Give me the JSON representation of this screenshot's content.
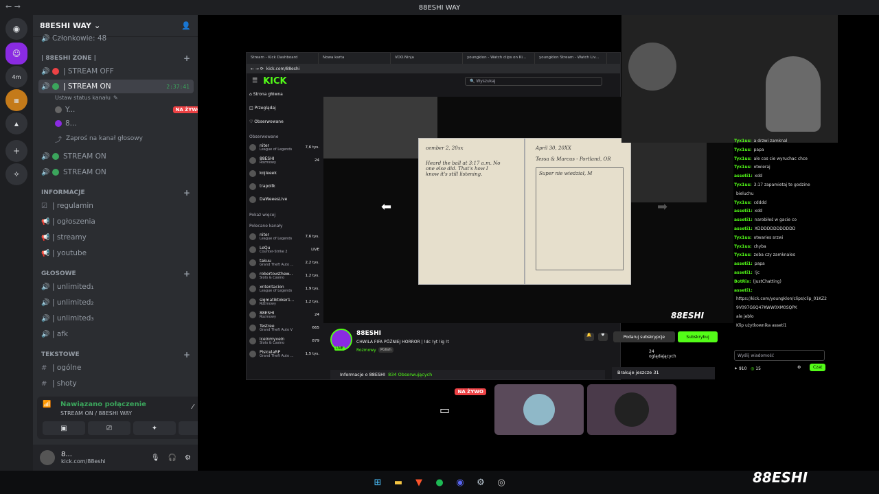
{
  "titlebar": {
    "title": "88ESHI WAY"
  },
  "server": {
    "name": "88ESHI WAY",
    "members_partial": "Członkowie: 48"
  },
  "channels": {
    "zone_category": "| 88ESHI ZONE |",
    "stream_off": "| STREAM OFF",
    "stream_on": "| STREAM ON",
    "stream_on_timer": "2:37:41",
    "status_hint": "Ustaw status kanału",
    "user1": "Y...",
    "user2": "8...",
    "live_badge": "NA ŻYWO",
    "invite": "Zaproś na kanał głosowy",
    "stream_on_2": "STREAM ON",
    "stream_on_3": "STREAM ON",
    "info_category": "INFORMACJE",
    "regulamin": "| regulamin",
    "ogloszenia": "| ogłoszenia",
    "streamy": "| streamy",
    "youtube": "| youtube",
    "voice_category": "GŁOSOWE",
    "unlimited1": "| unlimited₁",
    "unlimited2": "| unlimited₂",
    "unlimited3": "| unlimited₃",
    "afk": "| afk",
    "text_category": "TEKSTOWE",
    "ogolne": "| ogólne",
    "shoty": "| shoty"
  },
  "voice": {
    "status": "Nawiązano połączenie",
    "channel": "STREAM ON / 88ESHI WAY"
  },
  "user": {
    "name": "8...",
    "status": "kick.com/88eshi"
  },
  "browser": {
    "tabs": [
      "Stream - Kick Dashboard",
      "Nowa karta",
      "VDO.Ninja",
      "youngklon - Watch clips on Ki...",
      "youngklon Stream - Watch Liv..."
    ],
    "url": "kick.com/88eshi",
    "search_placeholder": "Wyszukaj",
    "logo": "KICK",
    "nav": {
      "home": "Strona główna",
      "browse": "Przeglądaj",
      "following": "Obserwowane"
    },
    "followed_header": "Obserwowane",
    "followed": [
      {
        "name": "niter",
        "game": "League of Legends",
        "count": "7,6 tys."
      },
      {
        "name": "88ESHI",
        "game": "Rozmowy",
        "count": "24"
      },
      {
        "name": "kojleeek",
        "game": "",
        "count": ""
      },
      {
        "name": "trapollk",
        "game": "",
        "count": ""
      },
      {
        "name": "DaWeeesLive",
        "game": "",
        "count": ""
      }
    ],
    "show_more": "Pokaż więcej",
    "recommended_header": "Polecane kanały",
    "recommended": [
      {
        "name": "niter",
        "game": "League of Legends",
        "count": "7,6 tys."
      },
      {
        "name": "LeQu",
        "game": "Counter-Strike 2",
        "count": "LIVE"
      },
      {
        "name": "takuu",
        "game": "Grand Theft Auto ...",
        "count": "2,2 tys."
      },
      {
        "name": "robertovsthew...",
        "game": "Slots & Casino",
        "count": "1,2 tys."
      },
      {
        "name": "xntentacion",
        "game": "League of Legends",
        "count": "1,9 tys."
      },
      {
        "name": "sigmatiktoker1...",
        "game": "Rozmowy",
        "count": "1,2 tys."
      },
      {
        "name": "88ESHI",
        "game": "Rozmowy",
        "count": "24"
      },
      {
        "name": "Testree",
        "game": "Grand Theft Auto V",
        "count": "665"
      },
      {
        "name": "iceinmyvein",
        "game": "Slots & Casino",
        "count": "879"
      },
      {
        "name": "PisicelaRP",
        "game": "Grand Theft Auto ...",
        "count": "1,5 tys."
      }
    ],
    "journal": {
      "left_date": "cember 2, 20xx",
      "right_date": "April 30, 20XX",
      "right_sub": "Tessa & Marcus - Portland, OR",
      "left_text": "Heard the ball at 3:17 a.m. No one else did. That's how I know it's still listening.",
      "right_text": "Super nie wiedział, M"
    },
    "channel_name": "88ESHI",
    "stream_title": "CHWILA FIFA PÓŹNIEJ HORROR | !dc !yt !ig !t",
    "category": "Rozmowy",
    "tag": "Polish",
    "live": "LIVE",
    "gift_btn": "Podaruj subskrypcje",
    "sub_btn": "Subskrybuj",
    "viewers": "24 oglądających",
    "about": "Informacje o 88ESHI",
    "followers": "834 Obserwujących",
    "goal": "Brakuje jeszcze 31"
  },
  "chat": {
    "messages": [
      {
        "user": "Tyx1us:",
        "text": "a drzwi zamknal"
      },
      {
        "user": "Tyx1us:",
        "text": "papa"
      },
      {
        "user": "Tyx1us:",
        "text": "ale cos cie wyruchac chce"
      },
      {
        "user": "Tyx1us:",
        "text": "otwieraj"
      },
      {
        "user": "asseti1:",
        "text": "xdd"
      },
      {
        "user": "Tyx1us:",
        "text": "3:17 zapamietaj te godzine"
      },
      {
        "user": "",
        "text": "bieluchu"
      },
      {
        "user": "Tyx1us:",
        "text": "cdddd"
      },
      {
        "user": "asseti1:",
        "text": "xdd"
      },
      {
        "user": "asseti1:",
        "text": "narobiłeś w gacie co"
      },
      {
        "user": "asseti1:",
        "text": "XDDDDDDDDDDDD"
      },
      {
        "user": "Tyx1us:",
        "text": "otwaries srzwi"
      },
      {
        "user": "Tyx1us:",
        "text": "chyba"
      },
      {
        "user": "Tyx1us:",
        "text": "zoba czy zamknales"
      },
      {
        "user": "asseti1:",
        "text": "papa"
      },
      {
        "user": "asseti1:",
        "text": "!jc"
      },
      {
        "user": "BotRix:",
        "text": "(JustChatting)"
      },
      {
        "user": "asseti1:",
        "text": ""
      },
      {
        "user": "",
        "text": "https://kick.com/youngklon/clips/clip_01KZ2"
      },
      {
        "user": "",
        "text": "9V097G6Q47KWW0XM0SQPK"
      },
      {
        "user": "",
        "text": "ale jebło"
      },
      {
        "user": "",
        "text": "Klip użytkownika asseti1"
      }
    ],
    "input_placeholder": "Wyślij wiadomość",
    "points": "910",
    "points2": "15",
    "send": "Czat"
  },
  "tiles": {
    "live_badge": "NA ŻYWO"
  },
  "watermark": "88ESHI",
  "overlay_watermark": "88ESHI"
}
